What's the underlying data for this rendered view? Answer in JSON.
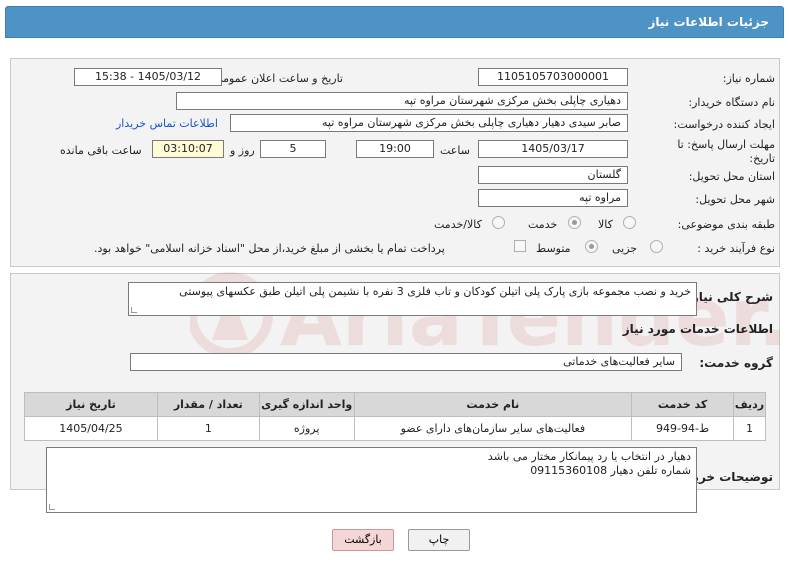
{
  "header": {
    "title": "جزئیات اطلاعات نیاز"
  },
  "form": {
    "need_number": {
      "label": "شماره نیاز:",
      "value": "1105105703000001"
    },
    "announce_datetime": {
      "label": "تاریخ و ساعت اعلان عمومی:",
      "value": "1405/03/12 - 15:38"
    },
    "buyer_org": {
      "label": "نام دستگاه خریدار:",
      "value": "دهیاری چاپلی بخش مرکزی شهرستان مراوه تپه"
    },
    "requester": {
      "label": "ایجاد کننده درخواست:",
      "value": "صابر سیدی دهیار دهیاری چاپلی بخش مرکزی شهرستان مراوه تپه"
    },
    "buyer_contact_link": "اطلاعات تماس خریدار",
    "deadline": {
      "label": "مهلت ارسال پاسخ: تا تاریخ:",
      "date": "1405/03/17",
      "time_label": "ساعت",
      "time": "19:00",
      "days": "5",
      "days_label": "روز و",
      "remaining": "03:10:07",
      "remaining_label": "ساعت باقی مانده"
    },
    "province": {
      "label": "استان محل تحویل:",
      "value": "گلستان"
    },
    "city": {
      "label": "شهر محل تحویل:",
      "value": "مراوه تپه"
    },
    "category": {
      "label": "طبقه بندی موضوعی:",
      "options": [
        "کالا",
        "خدمت",
        "کالا/خدمت"
      ],
      "selected": "خدمت"
    },
    "purchase_type": {
      "label": "نوع فرآیند خرید :",
      "options": [
        "جزیی",
        "متوسط"
      ],
      "selected": "متوسط",
      "payment_note": "پرداخت تمام یا بخشی از مبلغ خرید،از محل \"اسناد خزانه اسلامی\" خواهد بود."
    }
  },
  "description": {
    "label": "شرح کلی نیاز:",
    "value": "خرید و نصب مجموعه بازی پارک پلی اتیلن کودکان و تاب فلزی 3 نفره با نشیمن پلی اتیلن طبق عکسهای پیوستی"
  },
  "services": {
    "section_title": "اطلاعات خدمات مورد نیاز",
    "group_label": "گروه خدمت:",
    "group_value": "سایر فعالیت‌های خدماتی",
    "columns": [
      "ردیف",
      "کد خدمت",
      "نام خدمت",
      "واحد اندازه گیری",
      "تعداد / مقدار",
      "تاریخ نیاز"
    ],
    "rows": [
      [
        "1",
        "ط-94-949",
        "فعالیت‌های سایر سازمان‌های دارای عضو",
        "پروژه",
        "1",
        "1405/04/25"
      ]
    ]
  },
  "buyer_notes": {
    "label": "توضیحات خریدار:",
    "line1": "دهیار در انتخاب یا رد پیمانکار مختار می باشد",
    "line2": "شماره تلفن دهیار  09115360108"
  },
  "buttons": {
    "print": "چاپ",
    "back": "بازگشت"
  },
  "watermark": {
    "text": "AriaTender.net"
  },
  "colors": {
    "header": "#4e93c6",
    "panel": "#f3f3f3",
    "link": "#1a56c8",
    "back_button": "#f5d6d6"
  }
}
